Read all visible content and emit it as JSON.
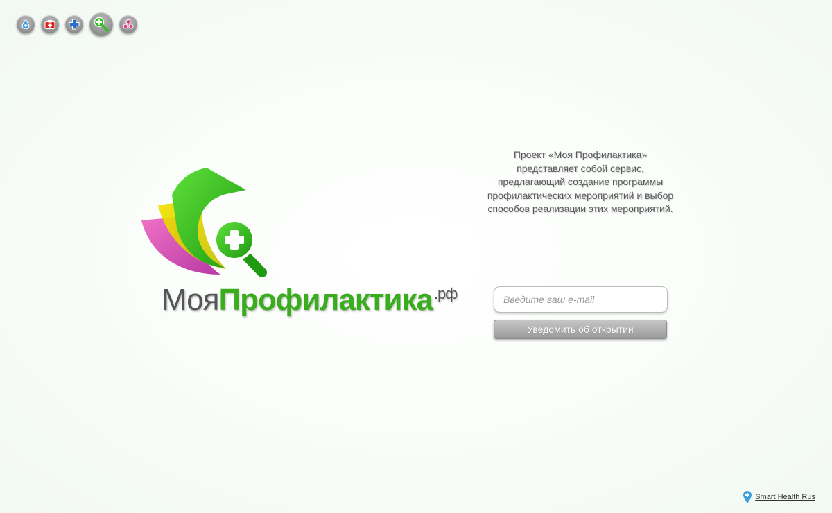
{
  "nav": {
    "buttons": [
      {
        "icon": "drop-icon",
        "color": "#3aa0e0"
      },
      {
        "icon": "first-aid-kit-icon",
        "color": "#e02020"
      },
      {
        "icon": "cross-icon",
        "color": "#2a6fd0"
      },
      {
        "icon": "magnifier-plus-icon",
        "color": "#2fc21a",
        "active": true
      },
      {
        "icon": "molecule-icon",
        "color": "#e03a8a"
      }
    ]
  },
  "brand": {
    "part1": "Моя",
    "part2": "Профилактика",
    "suffix": ".рф",
    "colors": {
      "gray": "#555555",
      "green": "#3aad1e"
    }
  },
  "description": {
    "lines": [
      "Проект «Моя Профилактика»",
      "представляет собой сервис,",
      "предлагающий создание программы",
      "профилактических мероприятий и выбор",
      "способов реализации этих мероприятий."
    ]
  },
  "form": {
    "email_placeholder": "Введите ваш e-mail",
    "email_value": "",
    "submit_label": "Уведомить об открытии"
  },
  "footer": {
    "link_text": "Smart Health Rus",
    "icon": "pin-icon"
  }
}
